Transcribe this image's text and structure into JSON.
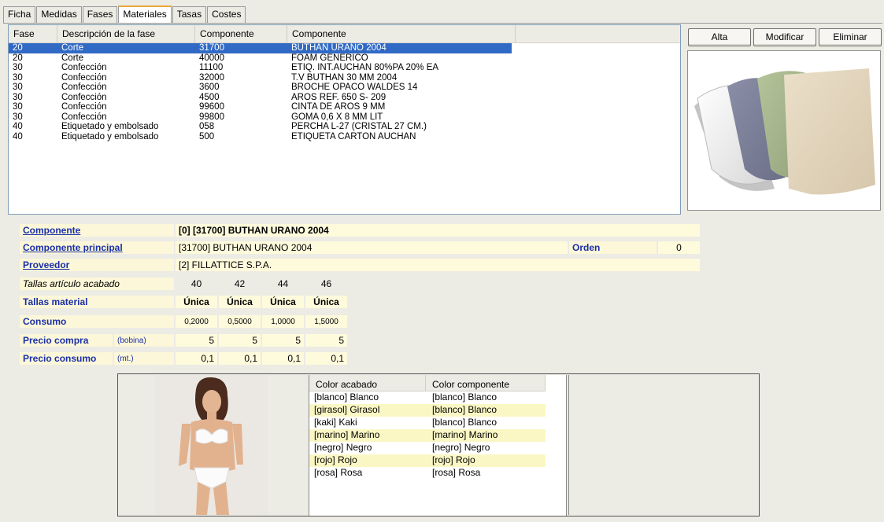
{
  "tabs": [
    "Ficha",
    "Medidas",
    "Fases",
    "Materiales",
    "Tasas",
    "Costes"
  ],
  "active_tab": "Materiales",
  "phases_table": {
    "headers": [
      "Fase",
      "Descripción de la fase",
      "Componente",
      "Componente"
    ],
    "rows": [
      {
        "fase": "20",
        "desc": "Corte",
        "comp": "31700",
        "nombre": "BUTHAN URANO 2004",
        "selected": true
      },
      {
        "fase": "20",
        "desc": "Corte",
        "comp": "40000",
        "nombre": "FOAM GENERICO"
      },
      {
        "fase": "30",
        "desc": "Confección",
        "comp": "11100",
        "nombre": "ETIQ. INT.AUCHAN 80%PA 20% EA"
      },
      {
        "fase": "30",
        "desc": "Confección",
        "comp": "32000",
        "nombre": "T.V BUTHAN 30 MM 2004"
      },
      {
        "fase": "30",
        "desc": "Confección",
        "comp": "3600",
        "nombre": "BROCHE OPACO WALDES 14"
      },
      {
        "fase": "30",
        "desc": "Confección",
        "comp": "4500",
        "nombre": "AROS REF. 650 S- 209"
      },
      {
        "fase": "30",
        "desc": "Confección",
        "comp": "99600",
        "nombre": "CINTA DE AROS 9 MM"
      },
      {
        "fase": "30",
        "desc": "Confección",
        "comp": "99800",
        "nombre": "GOMA 0,6 X 8 MM LIT"
      },
      {
        "fase": "40",
        "desc": "Etiquetado y embolsado",
        "comp": "058",
        "nombre": "PERCHA L-27 (CRISTAL 27 CM.)"
      },
      {
        "fase": "40",
        "desc": "Etiquetado y embolsado",
        "comp": "500",
        "nombre": "ETIQUETA CARTON AUCHAN"
      }
    ]
  },
  "buttons": {
    "alta": "Alta",
    "modificar": "Modificar",
    "eliminar": "Eliminar"
  },
  "detail": {
    "componente_label": "Componente",
    "componente_value": "[0] [31700] BUTHAN URANO 2004",
    "principal_label": "Componente principal",
    "principal_value": "[31700] BUTHAN URANO 2004",
    "orden_label": "Orden",
    "orden_value": "0",
    "proveedor_label": "Proveedor",
    "proveedor_value": "[2] FILLATTICE S.P.A.",
    "tallas_acabado_label": "Tallas artículo acabado",
    "tallas_acabado": [
      "40",
      "42",
      "44",
      "46"
    ],
    "tallas_material_label": "Tallas material",
    "tallas_material": [
      "Única",
      "Única",
      "Única",
      "Única"
    ],
    "consumo_label": "Consumo",
    "consumo": [
      "0,2000",
      "0,5000",
      "1,0000",
      "1,5000"
    ],
    "precio_compra_label": "Precio compra",
    "precio_compra_unit": "(bobina)",
    "precio_compra": [
      "5",
      "5",
      "5",
      "5"
    ],
    "precio_consumo_label": "Precio consumo",
    "precio_consumo_unit": "(mt.)",
    "precio_consumo": [
      "0,1",
      "0,1",
      "0,1",
      "0,1"
    ]
  },
  "color_table": {
    "headers": [
      "Color acabado",
      "Color componente"
    ],
    "rows": [
      {
        "acabado": "[blanco] Blanco",
        "componente": "[blanco] Blanco"
      },
      {
        "acabado": "[girasol] Girasol",
        "componente": "[blanco] Blanco"
      },
      {
        "acabado": "[kaki] Kaki",
        "componente": "[blanco] Blanco"
      },
      {
        "acabado": "[marino] Marino",
        "componente": "[marino] Marino"
      },
      {
        "acabado": "[negro] Negro",
        "componente": "[negro] Negro"
      },
      {
        "acabado": "[rojo] Rojo",
        "componente": "[rojo] Rojo"
      },
      {
        "acabado": "[rosa] Rosa",
        "componente": "[rosa] Rosa"
      }
    ]
  },
  "colors": {
    "selection": "#316ac5",
    "label_blue": "#1b2fa8",
    "field_yellow": "#fefadc",
    "tab_accent": "#e8a93a"
  }
}
